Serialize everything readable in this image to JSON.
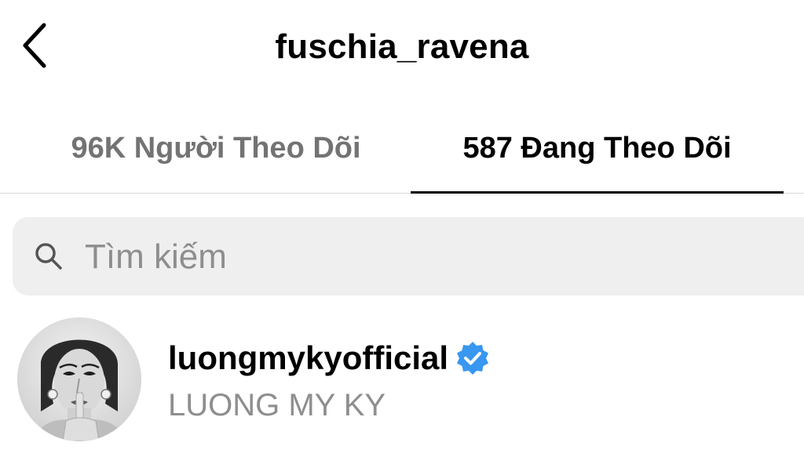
{
  "header": {
    "username": "fuschia_ravena",
    "back_icon": "chevron-left-icon"
  },
  "tabs": [
    {
      "label": "96K Người Theo Dõi",
      "active": false
    },
    {
      "label": "587 Đang Theo Dõi",
      "active": true
    }
  ],
  "search": {
    "placeholder": "Tìm kiếm",
    "icon": "search-icon"
  },
  "list": [
    {
      "username": "luongmykyofficial",
      "full_name": "LUONG MY KY",
      "verified": true,
      "avatar_icon": "avatar"
    }
  ],
  "colors": {
    "text_primary": "#000000",
    "text_secondary": "#8e8e8e",
    "inactive_tab": "#737373",
    "search_bg": "#efefef",
    "divider": "#dbdbdb",
    "verified_blue": "#3897f0"
  }
}
